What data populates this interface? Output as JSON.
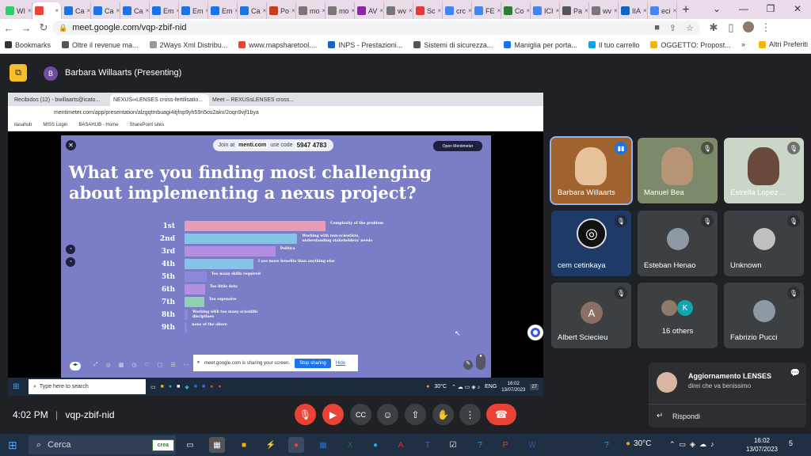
{
  "browser": {
    "tabs": [
      {
        "label": "WI",
        "color": "#25d366"
      },
      {
        "label": "",
        "color": "#ea4335",
        "active": true
      },
      {
        "label": "Ca",
        "color": "#1a73e8"
      },
      {
        "label": "Ca",
        "color": "#1a73e8"
      },
      {
        "label": "Ca",
        "color": "#1a73e8"
      },
      {
        "label": "Em",
        "color": "#1a73e8"
      },
      {
        "label": "Em",
        "color": "#1a73e8"
      },
      {
        "label": "Em",
        "color": "#1a73e8"
      },
      {
        "label": "Ca",
        "color": "#1a73e8"
      },
      {
        "label": "Po",
        "color": "#c43e1c"
      },
      {
        "label": "mo",
        "color": "#777777"
      },
      {
        "label": "mo",
        "color": "#777777"
      },
      {
        "label": "AV",
        "color": "#8e24aa"
      },
      {
        "label": "wv",
        "color": "#777777"
      },
      {
        "label": "Sc",
        "color": "#e53935"
      },
      {
        "label": "crc",
        "color": "#4285f4"
      },
      {
        "label": "FE",
        "color": "#4285f4"
      },
      {
        "label": "Co",
        "color": "#2e7d32"
      },
      {
        "label": "ICI",
        "color": "#4285f4"
      },
      {
        "label": "Pa",
        "color": "#555555"
      },
      {
        "label": "wv",
        "color": "#777777"
      },
      {
        "label": "IIA",
        "color": "#1565c0"
      },
      {
        "label": "eci",
        "color": "#4285f4"
      }
    ],
    "tab_close": "×",
    "new_tab": "+",
    "url": "meet.google.com/vqp-zbif-nid",
    "bookmarks": [
      {
        "label": "Bookmarks",
        "color": "#333333"
      },
      {
        "label": "Oltre il revenue ma...",
        "color": "#555555"
      },
      {
        "label": "2Ways Xml Distribu...",
        "color": "#999999"
      },
      {
        "label": "www.mapsharetool....",
        "color": "#ea4335"
      },
      {
        "label": "INPS - Prestazioni...",
        "color": "#1565c0"
      },
      {
        "label": "Sistemi di sicurezza...",
        "color": "#555555"
      },
      {
        "label": "Maniglia per porta...",
        "color": "#1a73e8"
      },
      {
        "label": "Il tuo carrello",
        "color": "#00a8e1"
      },
      {
        "label": "OGGETTO: Propost...",
        "color": "#f2b600"
      }
    ],
    "more_bookmarks": "»",
    "other_bookmarks": "Altri Preferiti",
    "profile_initial": ""
  },
  "meet": {
    "presenter_initial": "B",
    "presenter_label": "Barbara Willaarts (Presenting)",
    "time": "4:02 PM",
    "divider": "|",
    "meeting_code": "vqp-zbif-nid",
    "participants": [
      {
        "name": "Barbara Willaarts",
        "type": "video",
        "bg": "#a0622e",
        "speaking": true
      },
      {
        "name": "Manuel Bea",
        "type": "video",
        "bg": "#7c8a6a"
      },
      {
        "name": "Estrella Lopez ...",
        "type": "video",
        "bg": "#c9d6c8"
      },
      {
        "name": "cem cetinkaya",
        "type": "obs",
        "bg": "#1e3a66"
      },
      {
        "name": "Esteban Henao",
        "type": "photo",
        "bg": "#3c4043"
      },
      {
        "name": "Unknown",
        "type": "silhouette",
        "bg": "#3c4043"
      },
      {
        "name": "Albert Sciecieu",
        "type": "letter",
        "letter": "A",
        "bg": "#3c4043",
        "avatar_color": "#8d6e63"
      },
      {
        "name": "16 others",
        "type": "others",
        "letter": "K",
        "bg": "#3c4043",
        "avatar_color": "#12a4af"
      },
      {
        "name": "Fabrizio Pucci",
        "type": "photo",
        "bg": "#3c4043"
      }
    ],
    "notification": {
      "title": "Aggiornamento LENSES",
      "message": "direi che va benissimo",
      "reply": "Rispondi"
    }
  },
  "shared_screen": {
    "tabs": [
      "Recibidos (12) - bwillaarts@icato...",
      "NEXUS∞LENSES cross-fertilisatio...",
      "Meet – REXUSsLENSES cross..."
    ],
    "url": "mentimeter.com/app/presentation/alzgqtmbuagi4itjfnp9yh59n5os2akv/2oqn9vjf1bya",
    "bookmarks": [
      "ilasahub",
      "MISS Login",
      "BASAHUB - Home",
      "SharePoint sites"
    ],
    "join_prefix": "Join at",
    "join_site": "menti.com",
    "join_mid": "use code",
    "join_code": "5947 4783",
    "open_menti": "Open Mentimeter",
    "question": "What are you finding most challenging about implementing a nexus project?",
    "share_message": "meet.google.com is sharing your screen.",
    "stop_sharing": "Stop sharing",
    "hide": "Hide",
    "search_placeholder": "Type here to search",
    "weather": "30°C",
    "lang": "ENG",
    "clock_time": "16:02",
    "clock_date": "13/07/2023",
    "notif_count": "27"
  },
  "chart_data": {
    "type": "bar",
    "categories": [
      "1st",
      "2nd",
      "3rd",
      "4th",
      "5th",
      "6th",
      "7th",
      "8th",
      "9th"
    ],
    "labels": [
      "Complexity of the problem",
      "Working with non-scientists, understanding stakeholders' needs",
      "Politics",
      "I see more benefits than anything else",
      "Too many skills required",
      "Too little data",
      "Too expensive",
      "Working with too many scientific disciplines",
      "none of the above"
    ],
    "values": [
      9,
      7.2,
      5.8,
      4.4,
      1.4,
      1.3,
      1.25,
      0.2,
      0.15
    ],
    "colors": [
      "#e79bb6",
      "#84c4e6",
      "#b48fe0",
      "#84c4e6",
      "#8a8ad8",
      "#b48fe0",
      "#8fd0b0",
      "#8a8ad8",
      "#8a8ad8"
    ],
    "title": "What are you finding most challenging about implementing a nexus project?"
  },
  "taskbar": {
    "search_placeholder": "Cerca",
    "weather": "30°C",
    "clock_time": "16:02",
    "clock_date": "13/07/2023",
    "notif_count": "5",
    "crea_label": "crea"
  }
}
